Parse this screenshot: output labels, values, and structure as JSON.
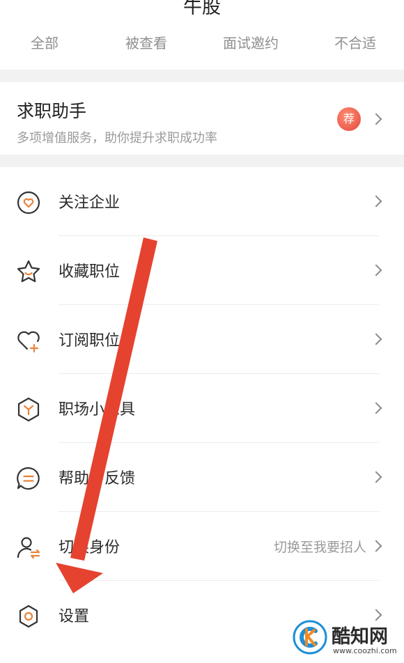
{
  "header": {
    "title": "牛股"
  },
  "tabs": [
    {
      "label": "全部"
    },
    {
      "label": "被查看"
    },
    {
      "label": "面试邀约"
    },
    {
      "label": "不合适"
    }
  ],
  "assistant": {
    "title": "求职助手",
    "subtitle": "多项增值服务，助你提升求职成功率",
    "badge": "荐"
  },
  "menu": [
    {
      "label": "关注企业",
      "icon": "heart-circle-icon"
    },
    {
      "label": "收藏职位",
      "icon": "star-smile-icon"
    },
    {
      "label": "订阅职位",
      "icon": "heart-plus-icon"
    },
    {
      "label": "职场小工具",
      "icon": "toolbox-hexagon-icon"
    },
    {
      "label": "帮助与反馈",
      "icon": "chat-bubble-icon"
    },
    {
      "label": "切换身份",
      "icon": "user-switch-icon",
      "right_text": "切换至我要招人"
    },
    {
      "label": "设置",
      "icon": "gear-icon"
    }
  ],
  "watermark": {
    "name": "酷知网",
    "url": "www.coozhi.com"
  },
  "colors": {
    "accent": "#e8833a",
    "annotation_arrow": "#e5432f",
    "badge": "#e24a3c"
  }
}
